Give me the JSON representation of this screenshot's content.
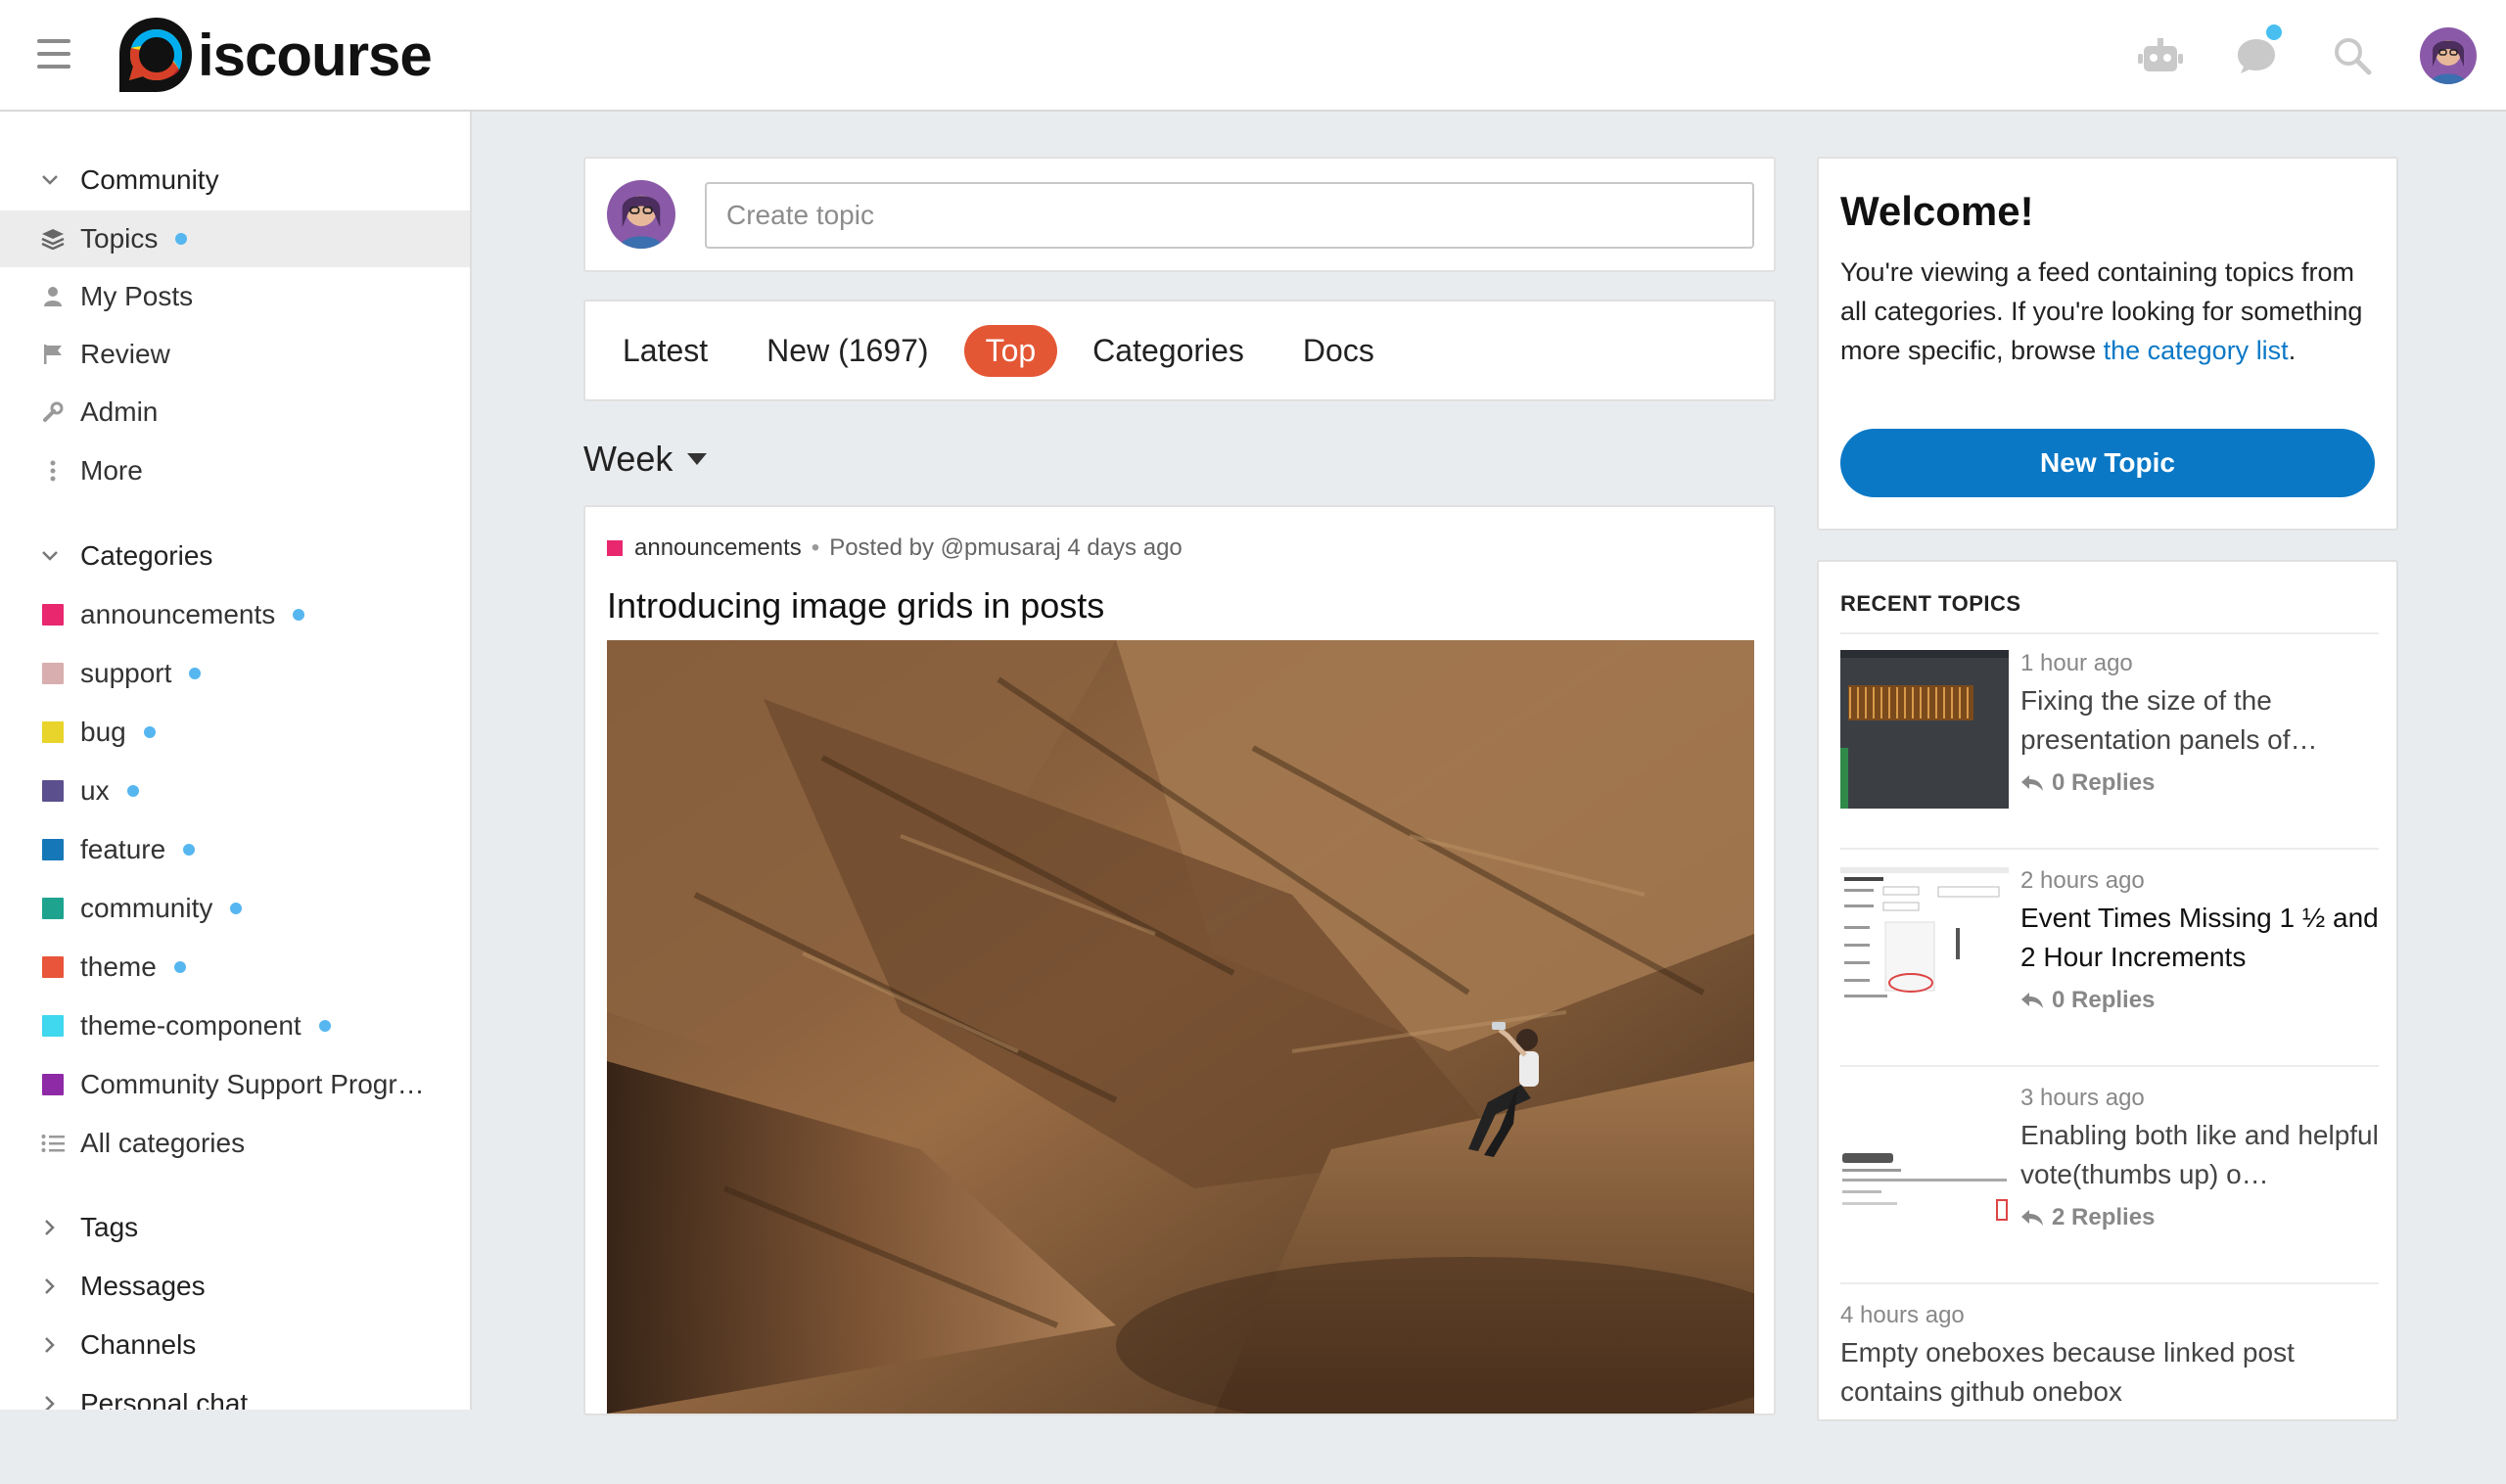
{
  "header": {
    "logo_text": "iscourse",
    "icons": [
      "hamburger-icon",
      "robot-icon",
      "chat-icon",
      "search-icon",
      "avatar"
    ]
  },
  "sidebar": {
    "community_label": "Community",
    "community_items": [
      {
        "label": "Topics",
        "icon": "layers-icon",
        "dot": true
      },
      {
        "label": "My Posts",
        "icon": "user-icon",
        "dot": false
      },
      {
        "label": "Review",
        "icon": "flag-icon",
        "dot": false
      },
      {
        "label": "Admin",
        "icon": "wrench-icon",
        "dot": false
      },
      {
        "label": "More",
        "icon": "more-vertical-icon",
        "dot": false
      }
    ],
    "categories_label": "Categories",
    "categories": [
      {
        "label": "announcements",
        "color": "#e8276f",
        "dot": true
      },
      {
        "label": "support",
        "color": "#d9aeae",
        "dot": true
      },
      {
        "label": "bug",
        "color": "#e8d42a",
        "dot": true
      },
      {
        "label": "ux",
        "color": "#5c4f8e",
        "dot": true
      },
      {
        "label": "feature",
        "color": "#1677b8",
        "dot": true
      },
      {
        "label": "community",
        "color": "#1ea38f",
        "dot": true
      },
      {
        "label": "theme",
        "color": "#e8553a",
        "dot": true
      },
      {
        "label": "theme-component",
        "color": "#3fd8ee",
        "dot": true
      },
      {
        "label": "Community Support Progr…",
        "color": "#8e2aa6",
        "dot": false
      }
    ],
    "all_categories": "All categories",
    "sections": [
      "Tags",
      "Messages",
      "Channels",
      "Personal chat"
    ]
  },
  "composer": {
    "placeholder": "Create topic"
  },
  "nav": {
    "items": [
      "Latest",
      "New (1697)",
      "Top",
      "Categories",
      "Docs"
    ],
    "active": "Top"
  },
  "period": {
    "label": "Week"
  },
  "post": {
    "category": "announcements",
    "byline": "Posted by @pmusaraj 4 days ago",
    "title": "Introducing image grids in posts"
  },
  "welcome": {
    "title": "Welcome!",
    "body": "You're viewing a feed containing topics from all categories. If you're looking for something more specific, browse ",
    "link": "the category list",
    "end": ".",
    "button": "New Topic"
  },
  "recent": {
    "heading": "RECENT TOPICS",
    "topics": [
      {
        "when": "1 hour ago",
        "title": "Fixing the size of the presentation panels of…",
        "replies": "0 Replies"
      },
      {
        "when": "2 hours ago",
        "title": "Event Times Missing 1 ½ and 2 Hour Increments",
        "replies": "0 Replies"
      },
      {
        "when": "3 hours ago",
        "title": "Enabling both like and helpful vote(thumbs up) o…",
        "replies": "2 Replies"
      },
      {
        "when": "4 hours ago",
        "title": "Empty oneboxes because linked post contains github onebox",
        "replies": ""
      }
    ]
  },
  "colors": {
    "accent": "#e45735",
    "primary_button": "#0b78c6",
    "link": "#0b78c6",
    "unread_dot": "#56b6f0"
  }
}
